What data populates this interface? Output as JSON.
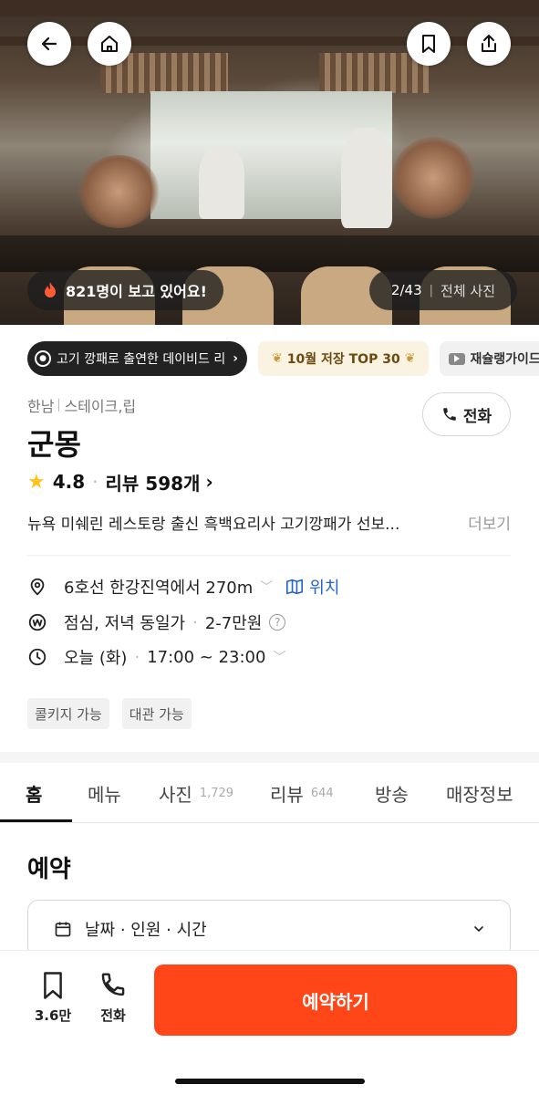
{
  "hero": {
    "viewers_text": "821명이 보고 있어요!",
    "photo_index": "2/43",
    "photo_all_label": "전체 사진",
    "buttons": [
      "back-icon",
      "home-icon",
      "bookmark-icon",
      "share-icon"
    ]
  },
  "badges": {
    "feature_label": "고기 깡패로 출연한 데이비드 리",
    "top_label": "10월 저장 TOP 30",
    "guide_label": "재슐랭가이드"
  },
  "restaurant": {
    "area": "한남",
    "category": "스테이크,립",
    "name": "군몽",
    "rating": "4.8",
    "review_label": "리뷰 598개",
    "description": "뉴욕 미쉐린 레스토랑 출신 흑백요리사 고기깡패가 선보...",
    "more_label": "더보기",
    "call_label": "전화"
  },
  "info": {
    "location": "6호선 한강진역에서 270m",
    "map_label": "위치",
    "price_meals": "점심, 저녁 동일가",
    "price_range": "2-7만원",
    "hours_day": "오늘 (화)",
    "hours_time": "17:00 ~ 23:00"
  },
  "tags": [
    "콜키지 가능",
    "대관 가능"
  ],
  "tabs": [
    {
      "label": "홈",
      "count": ""
    },
    {
      "label": "메뉴",
      "count": ""
    },
    {
      "label": "사진",
      "count": "1,729"
    },
    {
      "label": "리뷰",
      "count": "644"
    },
    {
      "label": "방송",
      "count": ""
    },
    {
      "label": "매장정보",
      "count": ""
    }
  ],
  "reservation": {
    "title": "예약",
    "selector_label": "날짜 · 인원 · 시간"
  },
  "bottom_bar": {
    "save_count": "3.6만",
    "call_label": "전화",
    "reserve_label": "예약하기"
  },
  "colors": {
    "accent": "#ff4619",
    "link": "#2463c9",
    "star": "#ffc21a"
  }
}
